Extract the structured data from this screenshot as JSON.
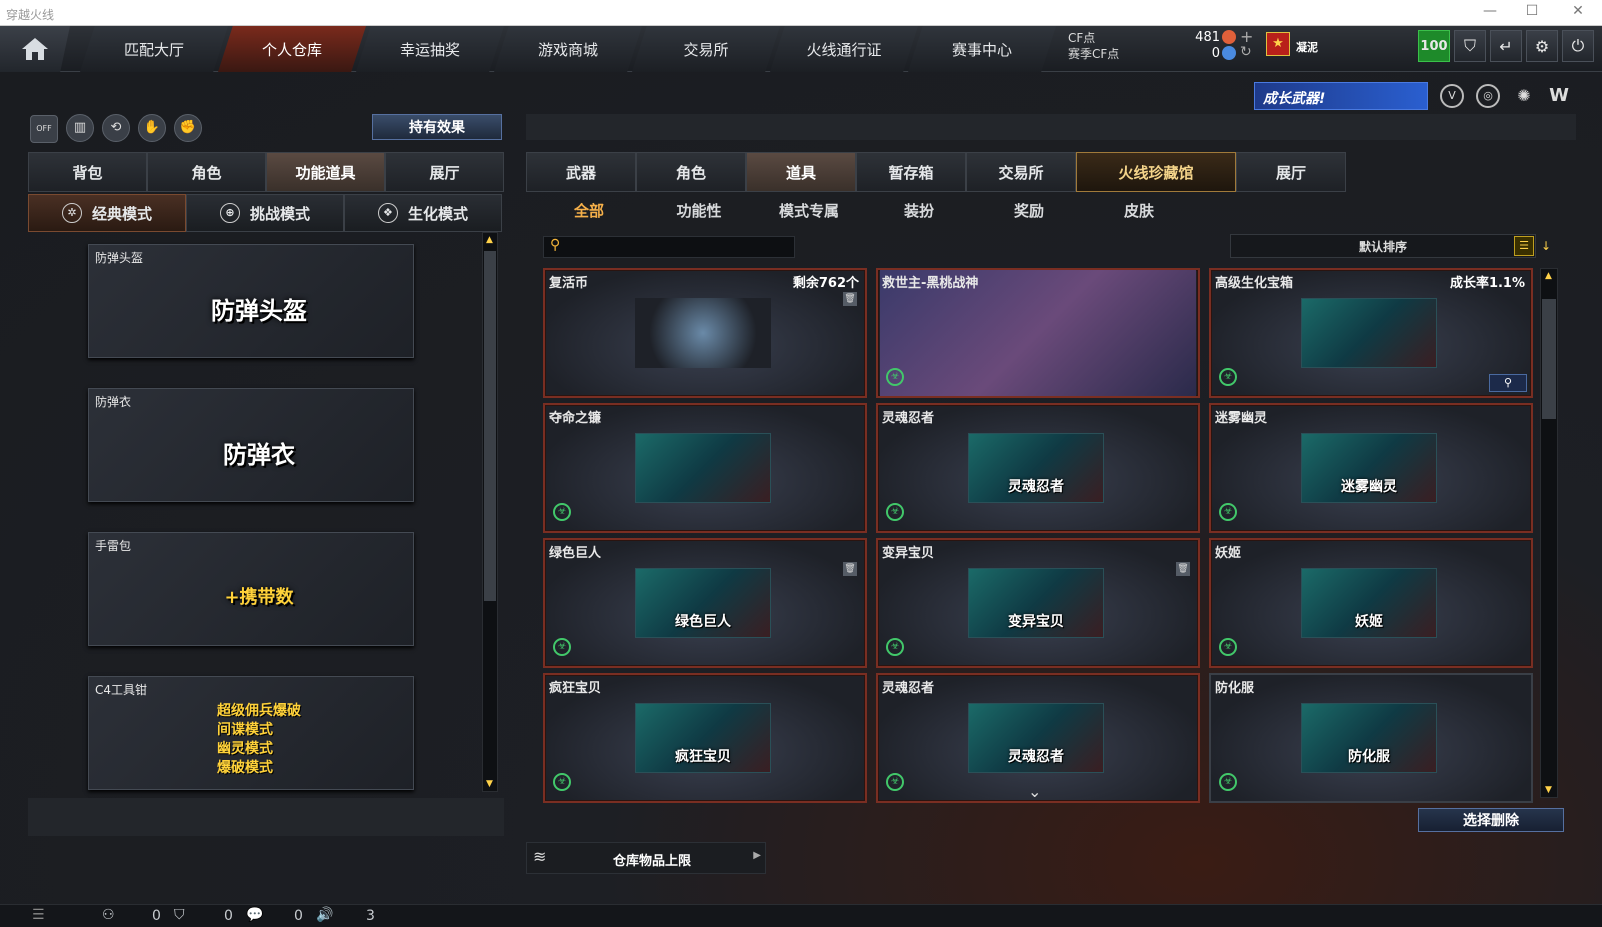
{
  "window": {
    "title": "穿越火线"
  },
  "nav": {
    "tabs": [
      "匹配大厅",
      "个人仓库",
      "幸运抽奖",
      "游戏商城",
      "交易所",
      "火线通行证",
      "赛事中心"
    ],
    "active": 1,
    "cf_label": "CF点",
    "season_cf_label": "赛季CF点",
    "cf_value": "481",
    "season_cf_value": "0",
    "user_name": "凝泥",
    "level": "100"
  },
  "banner": {
    "growth_weapon": "成长武器!"
  },
  "left": {
    "off_label": "OFF",
    "holding_effect_button": "持有效果",
    "tabs": [
      "背包",
      "角色",
      "功能道具",
      "展厅"
    ],
    "active_tab": 2,
    "modes": [
      "经典模式",
      "挑战模式",
      "生化模式"
    ],
    "cards": [
      {
        "label": "防弹头盔",
        "art": "防弹头盔"
      },
      {
        "label": "防弹衣",
        "art": "防弹衣"
      },
      {
        "label": "手雷包",
        "art": "+携带数"
      },
      {
        "label": "C4工具钳",
        "art_lines": [
          "超级佣兵爆破",
          "间谍模式",
          "幽灵模式",
          "爆破模式"
        ]
      }
    ]
  },
  "right": {
    "tabs": [
      "武器",
      "角色",
      "道具",
      "暂存箱",
      "交易所",
      "火线珍藏馆",
      "展厅"
    ],
    "active_tab": 2,
    "gold_tab": 5,
    "subtabs": [
      "全部",
      "功能性",
      "模式专属",
      "装扮",
      "奖励",
      "皮肤"
    ],
    "active_subtab": 0,
    "search_placeholder": "",
    "sort_label": "默认排序",
    "items": [
      {
        "name": "复活币",
        "extra": "剩余762个"
      },
      {
        "name": "救世主-黑桃战神",
        "extra": ""
      },
      {
        "name": "高级生化宝箱",
        "extra": "成长率1.1%"
      },
      {
        "name": "夺命之镰",
        "extra": ""
      },
      {
        "name": "灵魂忍者",
        "extra": "",
        "art": "灵魂忍者"
      },
      {
        "name": "迷雾幽灵",
        "extra": "",
        "art": "迷雾幽灵"
      },
      {
        "name": "绿色巨人",
        "extra": "",
        "art": "绿色巨人"
      },
      {
        "name": "变异宝贝",
        "extra": "",
        "art": "变异宝贝"
      },
      {
        "name": "妖姬",
        "extra": "",
        "art": "妖姬"
      },
      {
        "name": "疯狂宝贝",
        "extra": "",
        "art": "疯狂宝贝"
      },
      {
        "name": "灵魂忍者",
        "extra": "",
        "art": "灵魂忍者"
      },
      {
        "name": "防化服",
        "extra": "",
        "art": "防化服"
      }
    ],
    "select_delete_button": "选择删除",
    "storage_limit_label": "仓库物品上限"
  },
  "status": {
    "c1": "0",
    "c2": "0",
    "c3": "0",
    "c4": "3"
  }
}
